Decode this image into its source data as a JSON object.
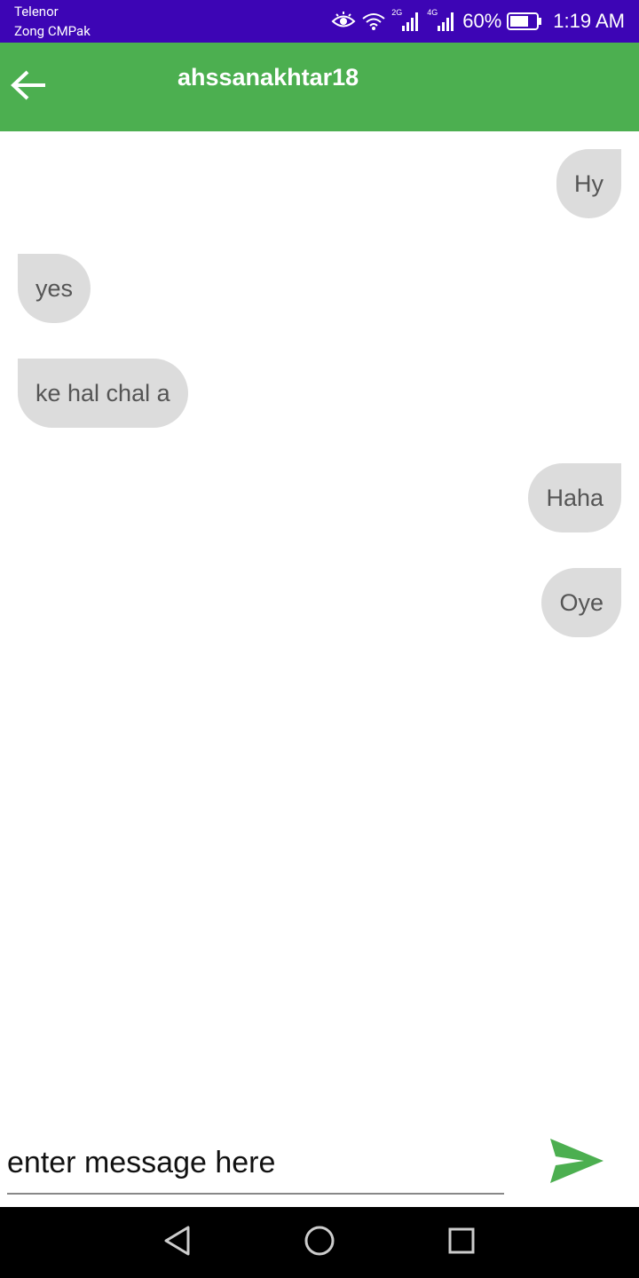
{
  "status_bar": {
    "carrier_1": "Telenor",
    "carrier_2": "Zong CMPak",
    "network_1": "2G",
    "network_2": "4G",
    "battery": "60%",
    "time": "1:19 AM",
    "icons": [
      "eye-icon",
      "wifi-icon",
      "signal-icon",
      "battery-icon"
    ]
  },
  "app_bar": {
    "title": "ahssanakhtar18",
    "back_icon": "arrow-back-icon",
    "color": "#4caf50"
  },
  "messages": [
    {
      "text": "Hy",
      "direction": "sent"
    },
    {
      "text": "yes",
      "direction": "received"
    },
    {
      "text": "ke hal chal a",
      "direction": "received"
    },
    {
      "text": "Haha",
      "direction": "sent"
    },
    {
      "text": "Oye",
      "direction": "sent"
    }
  ],
  "composer": {
    "placeholder": "enter message here",
    "value": "",
    "send_icon": "send-icon",
    "send_color": "#4caf50"
  },
  "nav_bar": {
    "icons": [
      "nav-back-icon",
      "nav-home-icon",
      "nav-recent-icon"
    ]
  }
}
